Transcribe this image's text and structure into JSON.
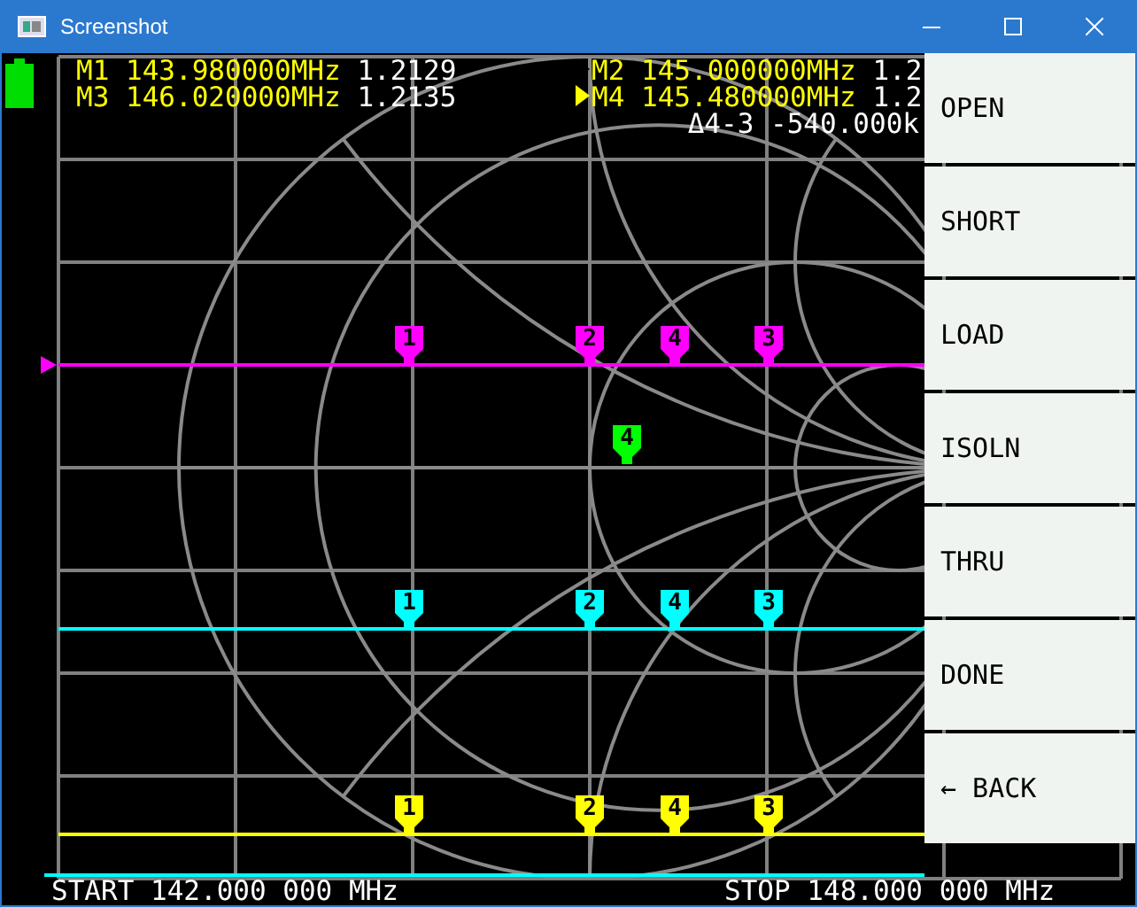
{
  "window": {
    "title": "Screenshot"
  },
  "markers": [
    {
      "label": "M1",
      "frequency": "143.980000MHz",
      "value": "1.2129",
      "active": false
    },
    {
      "label": "M2",
      "frequency": "145.000000MHz",
      "value": "1.2",
      "active": false
    },
    {
      "label": "M3",
      "frequency": "146.020000MHz",
      "value": "1.2135",
      "active": false
    },
    {
      "label": "M4",
      "frequency": "145.480000MHz",
      "value": "1.2",
      "active": true
    }
  ],
  "delta": {
    "label": "Δ4-3",
    "value": "-540.000k"
  },
  "traces": [
    {
      "color": "#ff00ff",
      "reference": true,
      "flags": [
        "1",
        "2",
        "4",
        "3"
      ]
    },
    {
      "color": "#00ffff",
      "reference": false,
      "flags": [
        "1",
        "2",
        "4",
        "3"
      ]
    },
    {
      "color": "#ffff00",
      "reference": false,
      "flags": [
        "1",
        "2",
        "4",
        "3"
      ]
    }
  ],
  "smith_marker": {
    "color": "#00ff00",
    "label": "4"
  },
  "menu": [
    {
      "label": "OPEN"
    },
    {
      "label": "SHORT"
    },
    {
      "label": "LOAD"
    },
    {
      "label": "ISOLN"
    },
    {
      "label": "THRU"
    },
    {
      "label": "DONE"
    },
    {
      "label": "← BACK"
    }
  ],
  "sweep": {
    "start": "START 142.000 000 MHz",
    "stop": "STOP 148.000 000 MHz"
  }
}
